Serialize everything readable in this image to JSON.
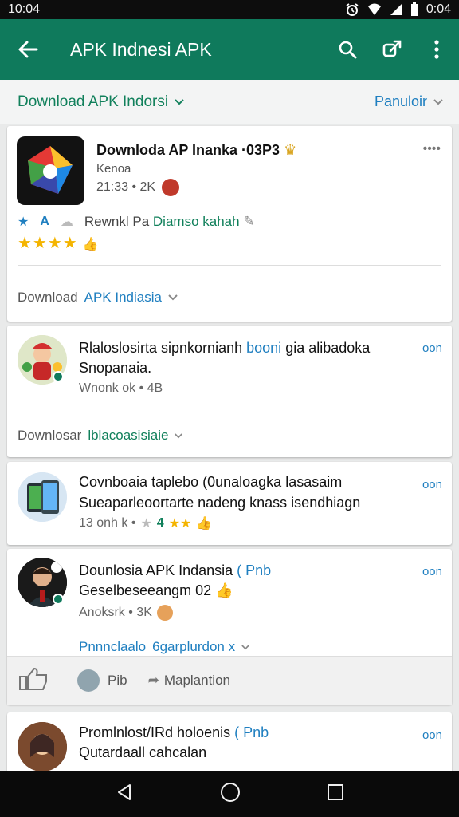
{
  "status": {
    "time": "10:04",
    "right_time": "0:04"
  },
  "appbar": {
    "title": "APK Indnesi APK"
  },
  "subbar": {
    "left_label": "Download APK Indorsi",
    "right_label": "Panuloir"
  },
  "featured": {
    "title": "Downloda AP Inanka ·03P3",
    "developer": "Kenoa",
    "meta": "21:33 • 2K",
    "tags": [
      "A"
    ],
    "tagline_prefix": "Rewnkl Pa",
    "tagline_highlight": "Diamso kahah",
    "link_prefix": "Download",
    "link_highlight": "APK Indiasia",
    "menu": "••••"
  },
  "cards": [
    {
      "title": "Rlaloslosirta sipnkornianh",
      "title_hl": "booni",
      "title_tail": "gia alibadoka",
      "line2": "Snopanaia.",
      "meta": "Wnonk ok • 4B",
      "lang": "oon",
      "link_prefix": "Downlosar",
      "link_highlight": "lblacoasisiaie"
    },
    {
      "title": "Covnboaia taplebo (0unaloagka",
      "title_hl": "",
      "title_tail": "lasasaim",
      "line2": "Sueaparleoortarte nadeng knass isendhiagn",
      "meta": "13 onh k •",
      "meta_num": "4",
      "lang": "oon"
    },
    {
      "title": "Dounlosia APK Indansia",
      "title_hl": "( Pnb",
      "title_tail": "",
      "line2": "Geselbeseeangm 02",
      "meta": "Anoksrk • 3K",
      "lang": "oon",
      "link_prefix": "Pnnnclaalo",
      "link_highlight": "6garplurdon x",
      "actions": {
        "user_label": "Pib",
        "share_label": "Maplantion"
      }
    },
    {
      "title": "Promlnlost/IRd holoenis",
      "title_hl": "( Pnb",
      "title_tail": "",
      "line2": "Qutardaall cahcalan",
      "lang": "oon"
    }
  ],
  "colors": {
    "brand": "#0f7a5c",
    "accent_blue": "#1f7fc0",
    "accent_green": "#11805b"
  }
}
